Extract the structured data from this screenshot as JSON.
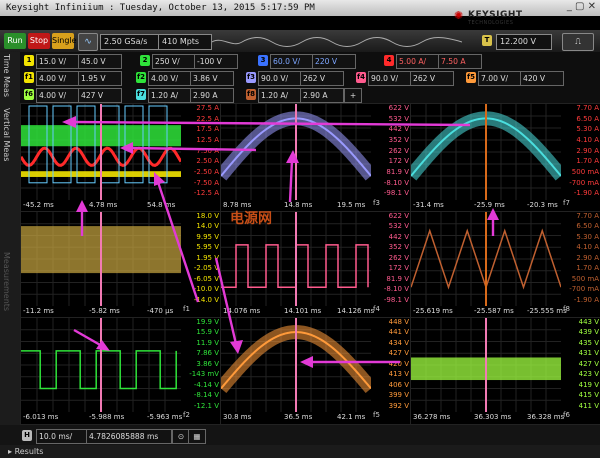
{
  "window": {
    "title": "Keysight Infiniium : Tuesday, October 13, 2015 5:17:59 PM"
  },
  "brand": {
    "name": "KEYSIGHT",
    "sub": "TECHNOLOGIES"
  },
  "toolbar": {
    "run": "Run",
    "stop": "Stop",
    "single": "Single",
    "sample_rate": "2.50 GSa/s",
    "memory": "410 Mpts",
    "trigger_level": "12.200 V",
    "trigger_badge": "T"
  },
  "channels": [
    {
      "id": "1",
      "scale": "15.0 V/",
      "offset": "45.0 V",
      "color": "#f2e300"
    },
    {
      "id": "2",
      "scale": "250 V/",
      "offset": "-100 V",
      "color": "#2fe33a"
    },
    {
      "id": "3",
      "scale": "60.0 V/",
      "offset": "220 V",
      "color": "#3a72ff"
    },
    {
      "id": "4",
      "scale": "5.00 A/",
      "offset": "7.50 A",
      "color": "#ff2a2a"
    }
  ],
  "functions": [
    {
      "id": "f1",
      "scale": "4.00 V/",
      "offset": "1.95 V",
      "color": "#f2e300"
    },
    {
      "id": "f2",
      "scale": "4.00 V/",
      "offset": "3.86 V",
      "color": "#2fe33a"
    },
    {
      "id": "f3",
      "scale": "90.0 V/",
      "offset": "262 V",
      "color": "#9a9aff"
    },
    {
      "id": "f4",
      "scale": "90.0 V/",
      "offset": "262 V",
      "color": "#ff5b8e"
    },
    {
      "id": "f5",
      "scale": "7.00 V/",
      "offset": "420 V",
      "color": "#ff9a3a"
    },
    {
      "id": "f6",
      "scale": "4.00 V/",
      "offset": "427 V",
      "color": "#a0ff40"
    },
    {
      "id": "f7",
      "scale": "1.20 A/",
      "offset": "2.90 A",
      "color": "#4adede"
    },
    {
      "id": "f8",
      "scale": "1.20 A/",
      "offset": "2.90 A",
      "color": "#c06030"
    }
  ],
  "sidebar": {
    "tab1": "Time Meas",
    "tab2": "Vertical Meas",
    "tab3": "Measurements"
  },
  "panes": [
    {
      "ylabels": [
        "27.5 A",
        "22.5 A",
        "17.5 A",
        "12.5 A",
        "7.50 A",
        "2.50 A",
        "-2.50 A",
        "-7.50 A",
        "-12.5 A"
      ],
      "xleft": "-45.2 ms",
      "xmid": "4.78 ms",
      "xright": "54.8 ms"
    },
    {
      "ylabels": [
        "622 V",
        "532 V",
        "442 V",
        "352 V",
        "262 V",
        "172 V",
        "81.9 V",
        "-8.10 V",
        "-98.1 V"
      ],
      "xleft": "8.78 ms",
      "xmid": "14.8 ms",
      "xright": "19.5 ms"
    },
    {
      "ylabels": [
        "7.70 A",
        "6.50 A",
        "5.30 A",
        "4.10 A",
        "2.90 A",
        "1.70 A",
        "500 mA",
        "-700 mA",
        "-1.90 A"
      ],
      "xleft": "-31.4 ms",
      "xmid": "-25.9 ms",
      "xright": "-20.3 ms"
    },
    {
      "ylabels": [
        "18.0 V",
        "14.0 V",
        "9.95 V",
        "5.95 V",
        "1.95 V",
        "-2.05 V",
        "-6.05 V",
        "-10.0 V",
        "-14.0 V"
      ],
      "xleft": "-11.2 ms",
      "xmid": "-5.82 ms",
      "xright": "-470 µs"
    },
    {
      "ylabels": [
        "622 V",
        "532 V",
        "442 V",
        "352 V",
        "262 V",
        "172 V",
        "81.9 V",
        "-8.10 V",
        "-98.1 V"
      ],
      "xleft": "14.076 ms",
      "xmid": "14.101 ms",
      "xright": "14.126 ms"
    },
    {
      "ylabels": [
        "7.70 A",
        "6.50 A",
        "5.30 A",
        "4.10 A",
        "2.90 A",
        "1.70 A",
        "500 mA",
        "-700 mA",
        "-1.90 A"
      ],
      "xleft": "-25.619 ms",
      "xmid": "-25.587 ms",
      "xright": "-25.555 ms"
    },
    {
      "ylabels": [
        "19.9 V",
        "15.9 V",
        "11.9 V",
        "7.86 V",
        "3.86 V",
        "-143 mV",
        "-4.14 V",
        "-8.14 V",
        "-12.1 V"
      ],
      "xleft": "-6.013 ms",
      "xmid": "-5.988 ms",
      "xright": "-5.963 ms"
    },
    {
      "ylabels": [
        "448 V",
        "441 V",
        "434 V",
        "427 V",
        "420 V",
        "413 V",
        "406 V",
        "399 V",
        "392 V"
      ],
      "xleft": "30.8 ms",
      "xmid": "36.5 ms",
      "xright": "42.1 ms"
    },
    {
      "ylabels": [
        "443 V",
        "439 V",
        "435 V",
        "431 V",
        "427 V",
        "423 V",
        "419 V",
        "415 V",
        "411 V"
      ],
      "xleft": "36.278 ms",
      "xmid": "36.303 ms",
      "xright": "36.328 ms"
    }
  ],
  "pane_tags": [
    "",
    "f3",
    "f7",
    "f1",
    "f4",
    "f8",
    "f2",
    "f5",
    "f6"
  ],
  "horizontal": {
    "badge": "H",
    "scale": "10.0 ms/",
    "position": "4.7826085888 ms"
  },
  "results": {
    "label": "Results"
  },
  "watermark": {
    "text": "电源网"
  }
}
